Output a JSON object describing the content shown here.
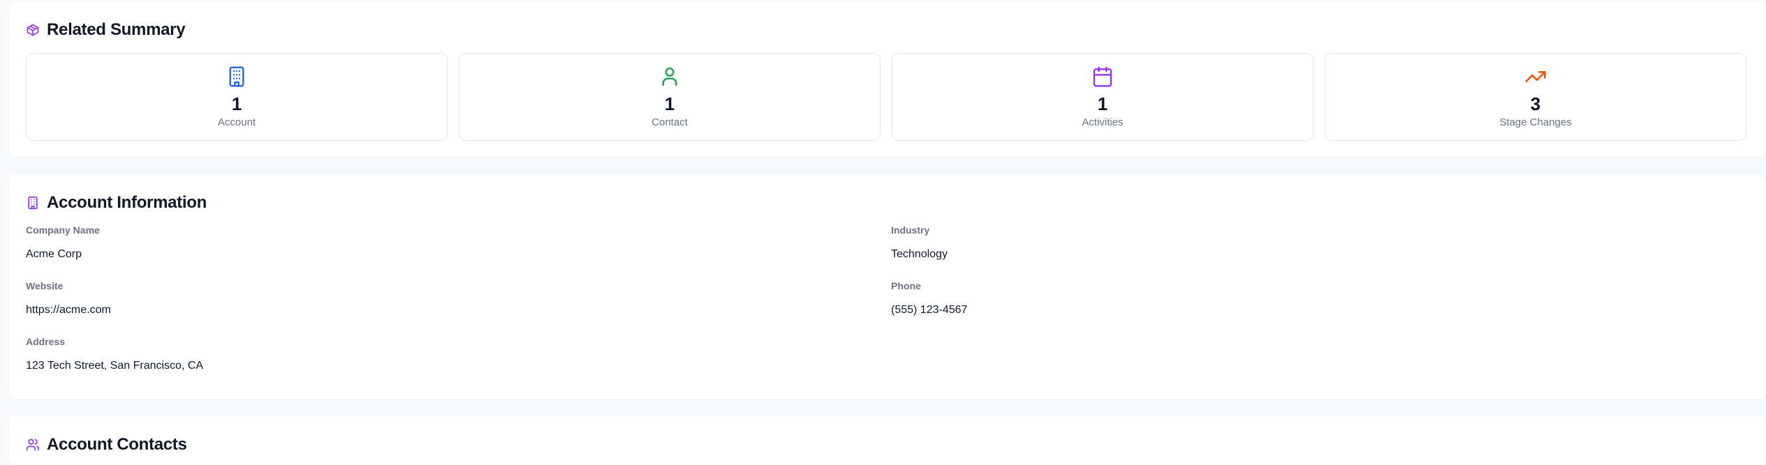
{
  "summary": {
    "title": "Related Summary",
    "stats": [
      {
        "value": "1",
        "label": "Account",
        "icon": "building-icon",
        "color": "#2563eb"
      },
      {
        "value": "1",
        "label": "Contact",
        "icon": "user-icon",
        "color": "#16a34a"
      },
      {
        "value": "1",
        "label": "Activities",
        "icon": "calendar-icon",
        "color": "#9333ea"
      },
      {
        "value": "3",
        "label": "Stage Changes",
        "icon": "trending-up-icon",
        "color": "#ea580c"
      }
    ]
  },
  "account": {
    "title": "Account Information",
    "fields": {
      "company_name": {
        "label": "Company Name",
        "value": "Acme Corp"
      },
      "industry": {
        "label": "Industry",
        "value": "Technology"
      },
      "website": {
        "label": "Website",
        "value": "https://acme.com"
      },
      "phone": {
        "label": "Phone",
        "value": "(555) 123-4567"
      },
      "address": {
        "label": "Address",
        "value": "123 Tech Street, San Francisco, CA"
      }
    }
  },
  "contacts": {
    "title": "Account Contacts"
  },
  "colors": {
    "accent": "#9333ea",
    "blue": "#2563eb",
    "green": "#16a34a",
    "purple": "#9333ea",
    "orange": "#ea580c"
  }
}
